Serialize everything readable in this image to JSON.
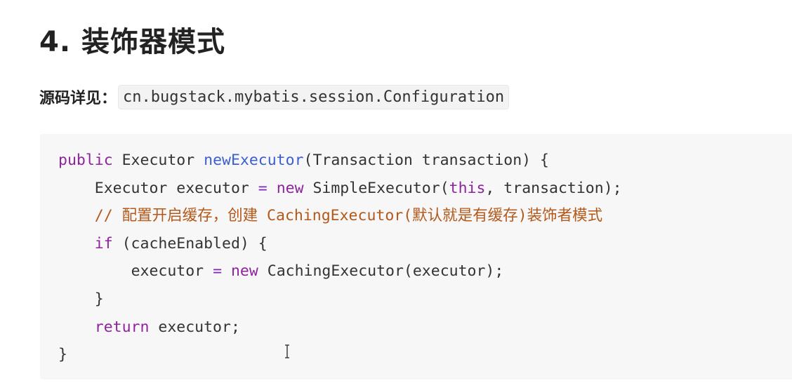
{
  "heading": "4. 装饰器模式",
  "source": {
    "label": "源码详见：",
    "path": "cn.bugstack.mybatis.session.Configuration"
  },
  "code": {
    "line1": {
      "kw": "public",
      "type": " Executor ",
      "fn": "newExecutor",
      "rest": "(Transaction transaction) {"
    },
    "line2": {
      "indent": "    ",
      "lhs": "Executor executor ",
      "eq": "=",
      "sp": " ",
      "kw_new": "new",
      "mid": " SimpleExecutor(",
      "kw_this": "this",
      "rest": ", transaction);"
    },
    "line3": {
      "indent": "    ",
      "comment": "// 配置开启缓存，创建 CachingExecutor(默认就是有缓存)装饰者模式"
    },
    "line4": {
      "indent": "    ",
      "kw": "if",
      "rest": " (cacheEnabled) {"
    },
    "line5": {
      "indent": "        ",
      "lhs": "executor ",
      "eq": "=",
      "sp": " ",
      "kw_new": "new",
      "rest": " CachingExecutor(executor);"
    },
    "line6": {
      "indent": "    ",
      "text": "}"
    },
    "line7": {
      "indent": "    ",
      "kw": "return",
      "rest": " executor;"
    },
    "line8": {
      "text": "}"
    }
  },
  "colors": {
    "keyword": "#8f239d",
    "function": "#3b5fd1",
    "operator": "#7d28b6",
    "comment": "#b4581a",
    "code_background": "#f7f7f7",
    "inline_code_background": "#f3f3f3"
  },
  "icons": {
    "cursor": "text-cursor-icon"
  }
}
